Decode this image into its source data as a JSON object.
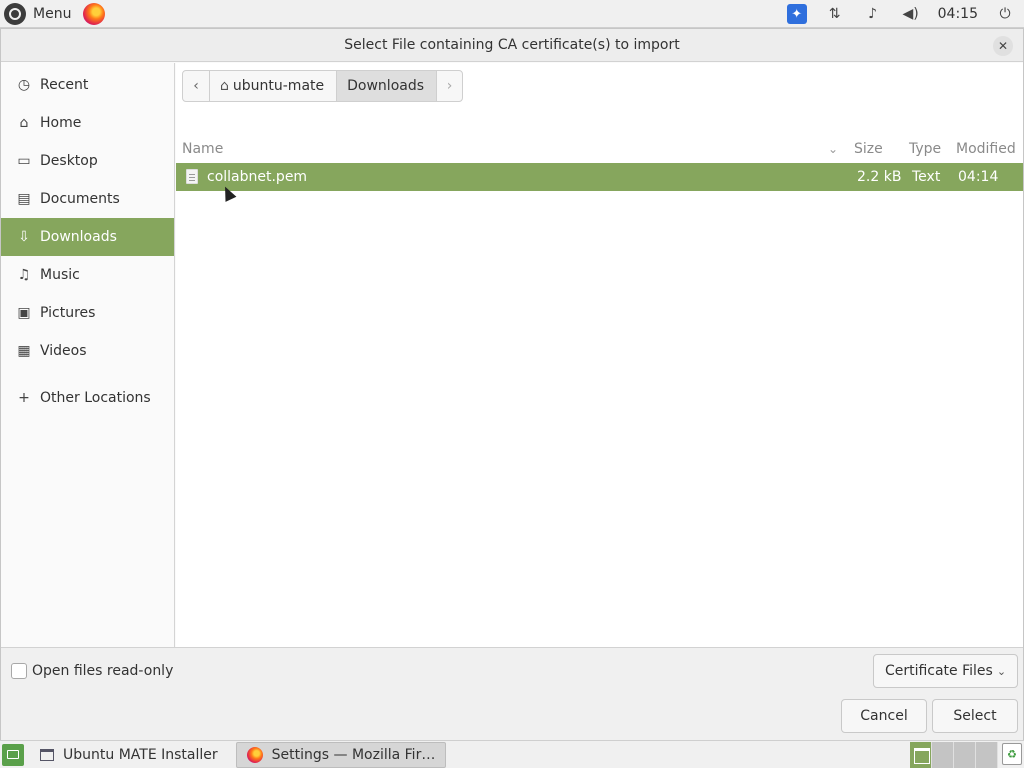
{
  "top_panel": {
    "menu_label": "Menu",
    "clock": "04:15",
    "icons": [
      "ubuntu-mate-logo-icon",
      "firefox-icon",
      "accessibility-icon",
      "network-icon",
      "notification-bell-icon",
      "volume-icon",
      "power-icon"
    ]
  },
  "dialog": {
    "title": "Select File containing CA certificate(s) to import",
    "close_glyph": "✕",
    "places": [
      {
        "label": "Recent",
        "icon": "clock-icon",
        "glyph": "◷"
      },
      {
        "label": "Home",
        "icon": "home-icon",
        "glyph": "⌂"
      },
      {
        "label": "Desktop",
        "icon": "desktop-icon",
        "glyph": "▭"
      },
      {
        "label": "Documents",
        "icon": "document-icon",
        "glyph": "▤"
      },
      {
        "label": "Downloads",
        "icon": "download-icon",
        "glyph": "⇩",
        "active": true
      },
      {
        "label": "Music",
        "icon": "music-icon",
        "glyph": "♫"
      },
      {
        "label": "Pictures",
        "icon": "picture-icon",
        "glyph": "▣"
      },
      {
        "label": "Videos",
        "icon": "video-icon",
        "glyph": "▦"
      }
    ],
    "other_locations": {
      "label": "Other Locations",
      "glyph": "+"
    },
    "pathbar": {
      "back_glyph": "‹",
      "forward_glyph": "›",
      "home_glyph": "⌂",
      "segments": [
        "ubuntu-mate",
        "Downloads"
      ]
    },
    "columns": {
      "name": "Name",
      "size": "Size",
      "type": "Type",
      "modified": "Modified",
      "sort_glyph": "⌄"
    },
    "files": [
      {
        "name": "collabnet.pem",
        "size": "2.2 kB",
        "type": "Text",
        "modified": "04:14",
        "selected": true
      }
    ],
    "readonly_label": "Open files read-only",
    "filter": {
      "value": "Certificate Files",
      "chevron": "⌄"
    },
    "buttons": {
      "cancel": "Cancel",
      "select": "Select"
    }
  },
  "taskbar": {
    "tasks": [
      {
        "label": "Ubuntu MATE Installer",
        "icon": "window-icon"
      },
      {
        "label": "Settings — Mozilla Fir…",
        "icon": "firefox-icon",
        "active": true
      }
    ],
    "trash_glyph": "♻"
  },
  "colors": {
    "accent": "#86a65d",
    "panel_bg": "#f0f0f0"
  }
}
